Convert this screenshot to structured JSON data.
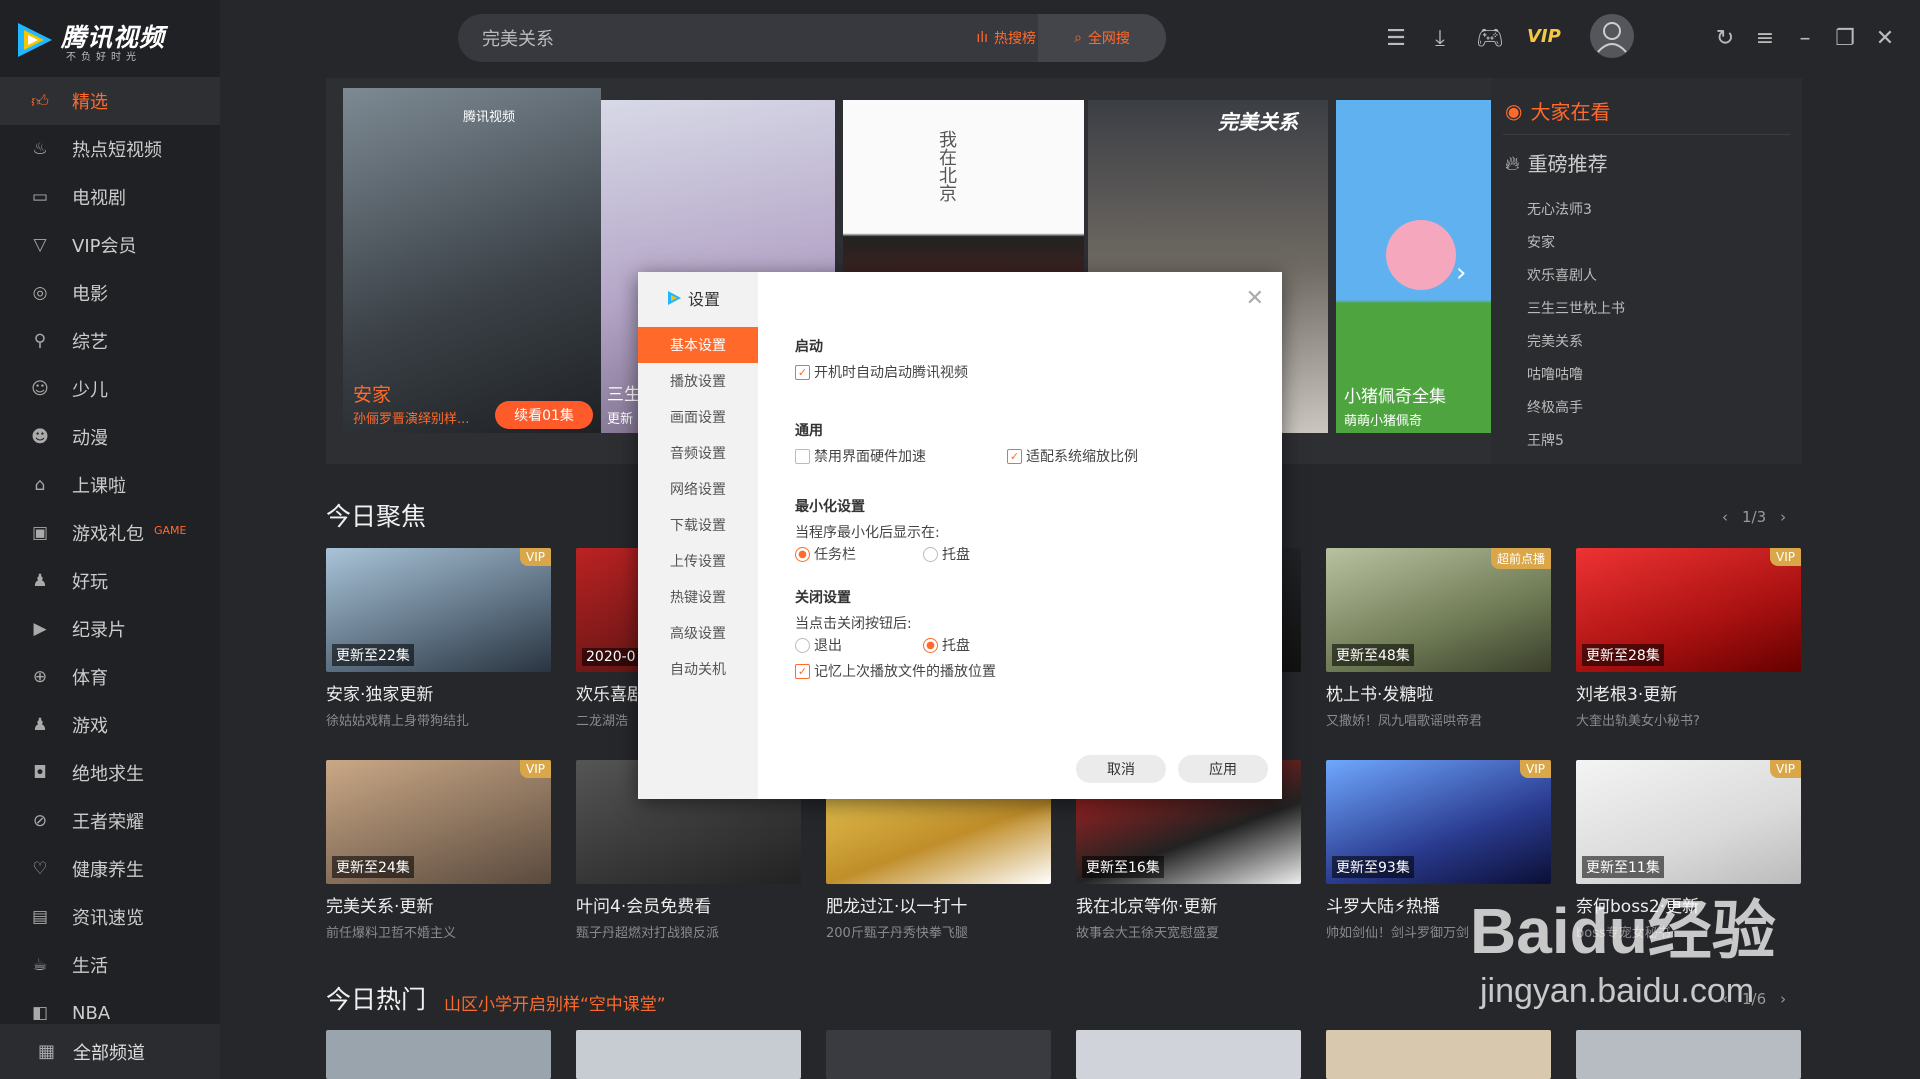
{
  "app": {
    "logo_title": "腾讯视频",
    "logo_slogan": "不负好时光"
  },
  "sidebar": {
    "items": [
      {
        "label": "精选",
        "icon": "thumbs-up-icon"
      },
      {
        "label": "热点短视频",
        "icon": "fire-icon"
      },
      {
        "label": "电视剧",
        "icon": "tv-icon"
      },
      {
        "label": "VIP会员",
        "icon": "vip-icon"
      },
      {
        "label": "电影",
        "icon": "film-reel-icon"
      },
      {
        "label": "综艺",
        "icon": "microphone-icon"
      },
      {
        "label": "少儿",
        "icon": "kid-icon"
      },
      {
        "label": "动漫",
        "icon": "anime-icon"
      },
      {
        "label": "上课啦",
        "icon": "graduation-cap-icon"
      },
      {
        "label": "游戏礼包",
        "tag": "GAME",
        "icon": "gamepad-icon"
      },
      {
        "label": "好玩",
        "icon": "joystick-icon"
      },
      {
        "label": "纪录片",
        "icon": "camera-icon"
      },
      {
        "label": "体育",
        "icon": "basketball-icon"
      },
      {
        "label": "游戏",
        "icon": "game-icon"
      },
      {
        "label": "绝地求生",
        "icon": "helmet-icon"
      },
      {
        "label": "王者荣耀",
        "icon": "sword-icon"
      },
      {
        "label": "健康养生",
        "icon": "heart-icon"
      },
      {
        "label": "资讯速览",
        "icon": "news-icon"
      },
      {
        "label": "生活",
        "icon": "cup-icon"
      },
      {
        "label": "NBA",
        "icon": "nba-icon"
      }
    ],
    "all_channels": "全部频道"
  },
  "search": {
    "value": "完美关系",
    "hot_label": "热搜榜",
    "all_label": "全网搜"
  },
  "topbar": {
    "vip": "VIP"
  },
  "banner": {
    "slide1": {
      "title": "安家",
      "subtitle": "孙俪罗晋演绎别样...",
      "button": "续看01集",
      "badge": "腾讯视频"
    },
    "slide2": {
      "title": "三生",
      "subtitle": "更新"
    },
    "slide5": {
      "title": "小猪佩奇全集",
      "subtitle": "萌萌小猪佩奇"
    },
    "slide4_logo": "完美关系",
    "slide3_text": "我在北京"
  },
  "hot": {
    "watching": "大家在看",
    "recommend": "重磅推荐",
    "items": [
      "无心法师3",
      "安家",
      "欢乐喜剧人",
      "三生三世枕上书",
      "完美关系",
      "咕噜咕噜",
      "终极高手",
      "王牌5"
    ]
  },
  "focus": {
    "title": "今日聚焦",
    "pager": "1/3",
    "row1": [
      {
        "title": "安家·独家更新",
        "sub": "徐姑姑戏精上身带狗结扎",
        "update": "更新至22集",
        "badge": "VIP"
      },
      {
        "title": "欢乐喜剧",
        "sub": "二龙湖浩",
        "update": "2020-0",
        "badge": ""
      },
      {
        "title": "",
        "sub": "",
        "update": "",
        "badge": ""
      },
      {
        "title": "",
        "sub": "",
        "update": "",
        "badge": ""
      },
      {
        "title": "枕上书·发糖啦",
        "sub": "又撒娇！凤九唱歌谣哄帝君",
        "update": "更新至48集",
        "badge": "超前点播"
      },
      {
        "title": "刘老根3·更新",
        "sub": "大奎出轨美女小秘书?",
        "update": "更新至28集",
        "badge": "VIP"
      }
    ],
    "row2": [
      {
        "title": "完美关系·更新",
        "sub": "前任爆料卫哲不婚主义",
        "update": "更新至24集",
        "badge": "VIP"
      },
      {
        "title": "叶问4·会员免费看",
        "sub": "甄子丹超燃对打战狼反派",
        "update": "",
        "badge": ""
      },
      {
        "title": "肥龙过江·以一打十",
        "sub": "200斤甄子丹秀快拳飞腿",
        "update": "",
        "badge": ""
      },
      {
        "title": "我在北京等你·更新",
        "sub": "故事会大王徐天宽慰盛夏",
        "update": "更新至16集",
        "badge": ""
      },
      {
        "title": "斗罗大陆⚡热播",
        "sub": "帅如剑仙！剑斗罗御万剑",
        "update": "更新至93集",
        "badge": "VIP"
      },
      {
        "title": "奈何boss2·更新",
        "sub": "boss专宠女秘书",
        "update": "更新至11集",
        "badge": "VIP"
      }
    ]
  },
  "hotnow": {
    "title": "今日热门",
    "sub": "山区小学开启别样“空中课堂”",
    "pager": "1/6"
  },
  "dialog": {
    "title": "设置",
    "nav": [
      "基本设置",
      "播放设置",
      "画面设置",
      "音频设置",
      "网络设置",
      "下载设置",
      "上传设置",
      "热键设置",
      "高级设置",
      "自动关机"
    ],
    "startup": {
      "heading": "启动",
      "autostart": "开机时自动启动腾讯视频"
    },
    "general": {
      "heading": "通用",
      "disable_hw": "禁用界面硬件加速",
      "scale": "适配系统缩放比例"
    },
    "minimize": {
      "heading": "最小化设置",
      "prompt": "当程序最小化后显示在:",
      "taskbar": "任务栏",
      "tray": "托盘"
    },
    "close": {
      "heading": "关闭设置",
      "prompt": "当点击关闭按钮后:",
      "exit": "退出",
      "tray": "托盘",
      "remember": "记忆上次播放文件的播放位置"
    },
    "cancel": "取消",
    "apply": "应用"
  },
  "watermark": {
    "brand": "Baidu经验",
    "url": "jingyan.baidu.com"
  }
}
